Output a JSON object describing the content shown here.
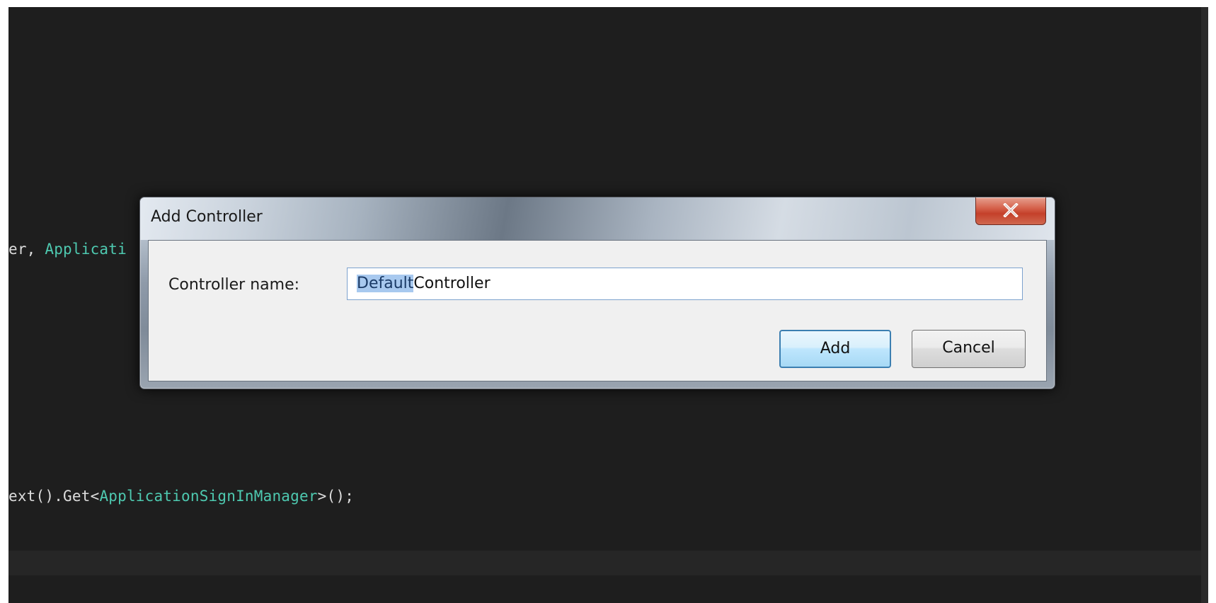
{
  "editor": {
    "code_lines": [
      {
        "plain_before": "er, ",
        "type_text": "Applicati",
        "plain_after": ""
      },
      {
        "plain_before": "ext().Get<",
        "type_text": "ApplicationSignInManager",
        "plain_after": ">();"
      }
    ]
  },
  "dialog": {
    "title": "Add Controller",
    "close_label": "x",
    "field_label": "Controller name:",
    "input": {
      "selected_text": "Default",
      "rest_text": "Controller"
    },
    "add_label": "Add",
    "cancel_label": "Cancel"
  },
  "colors": {
    "editor_background": "#1e1e1e",
    "code_text": "#dcdcdc",
    "type_name": "#4ec9b0",
    "selection": "#a8c9ef",
    "close_button_red": "#c4402a"
  },
  "icons": {
    "close": "close-icon"
  }
}
